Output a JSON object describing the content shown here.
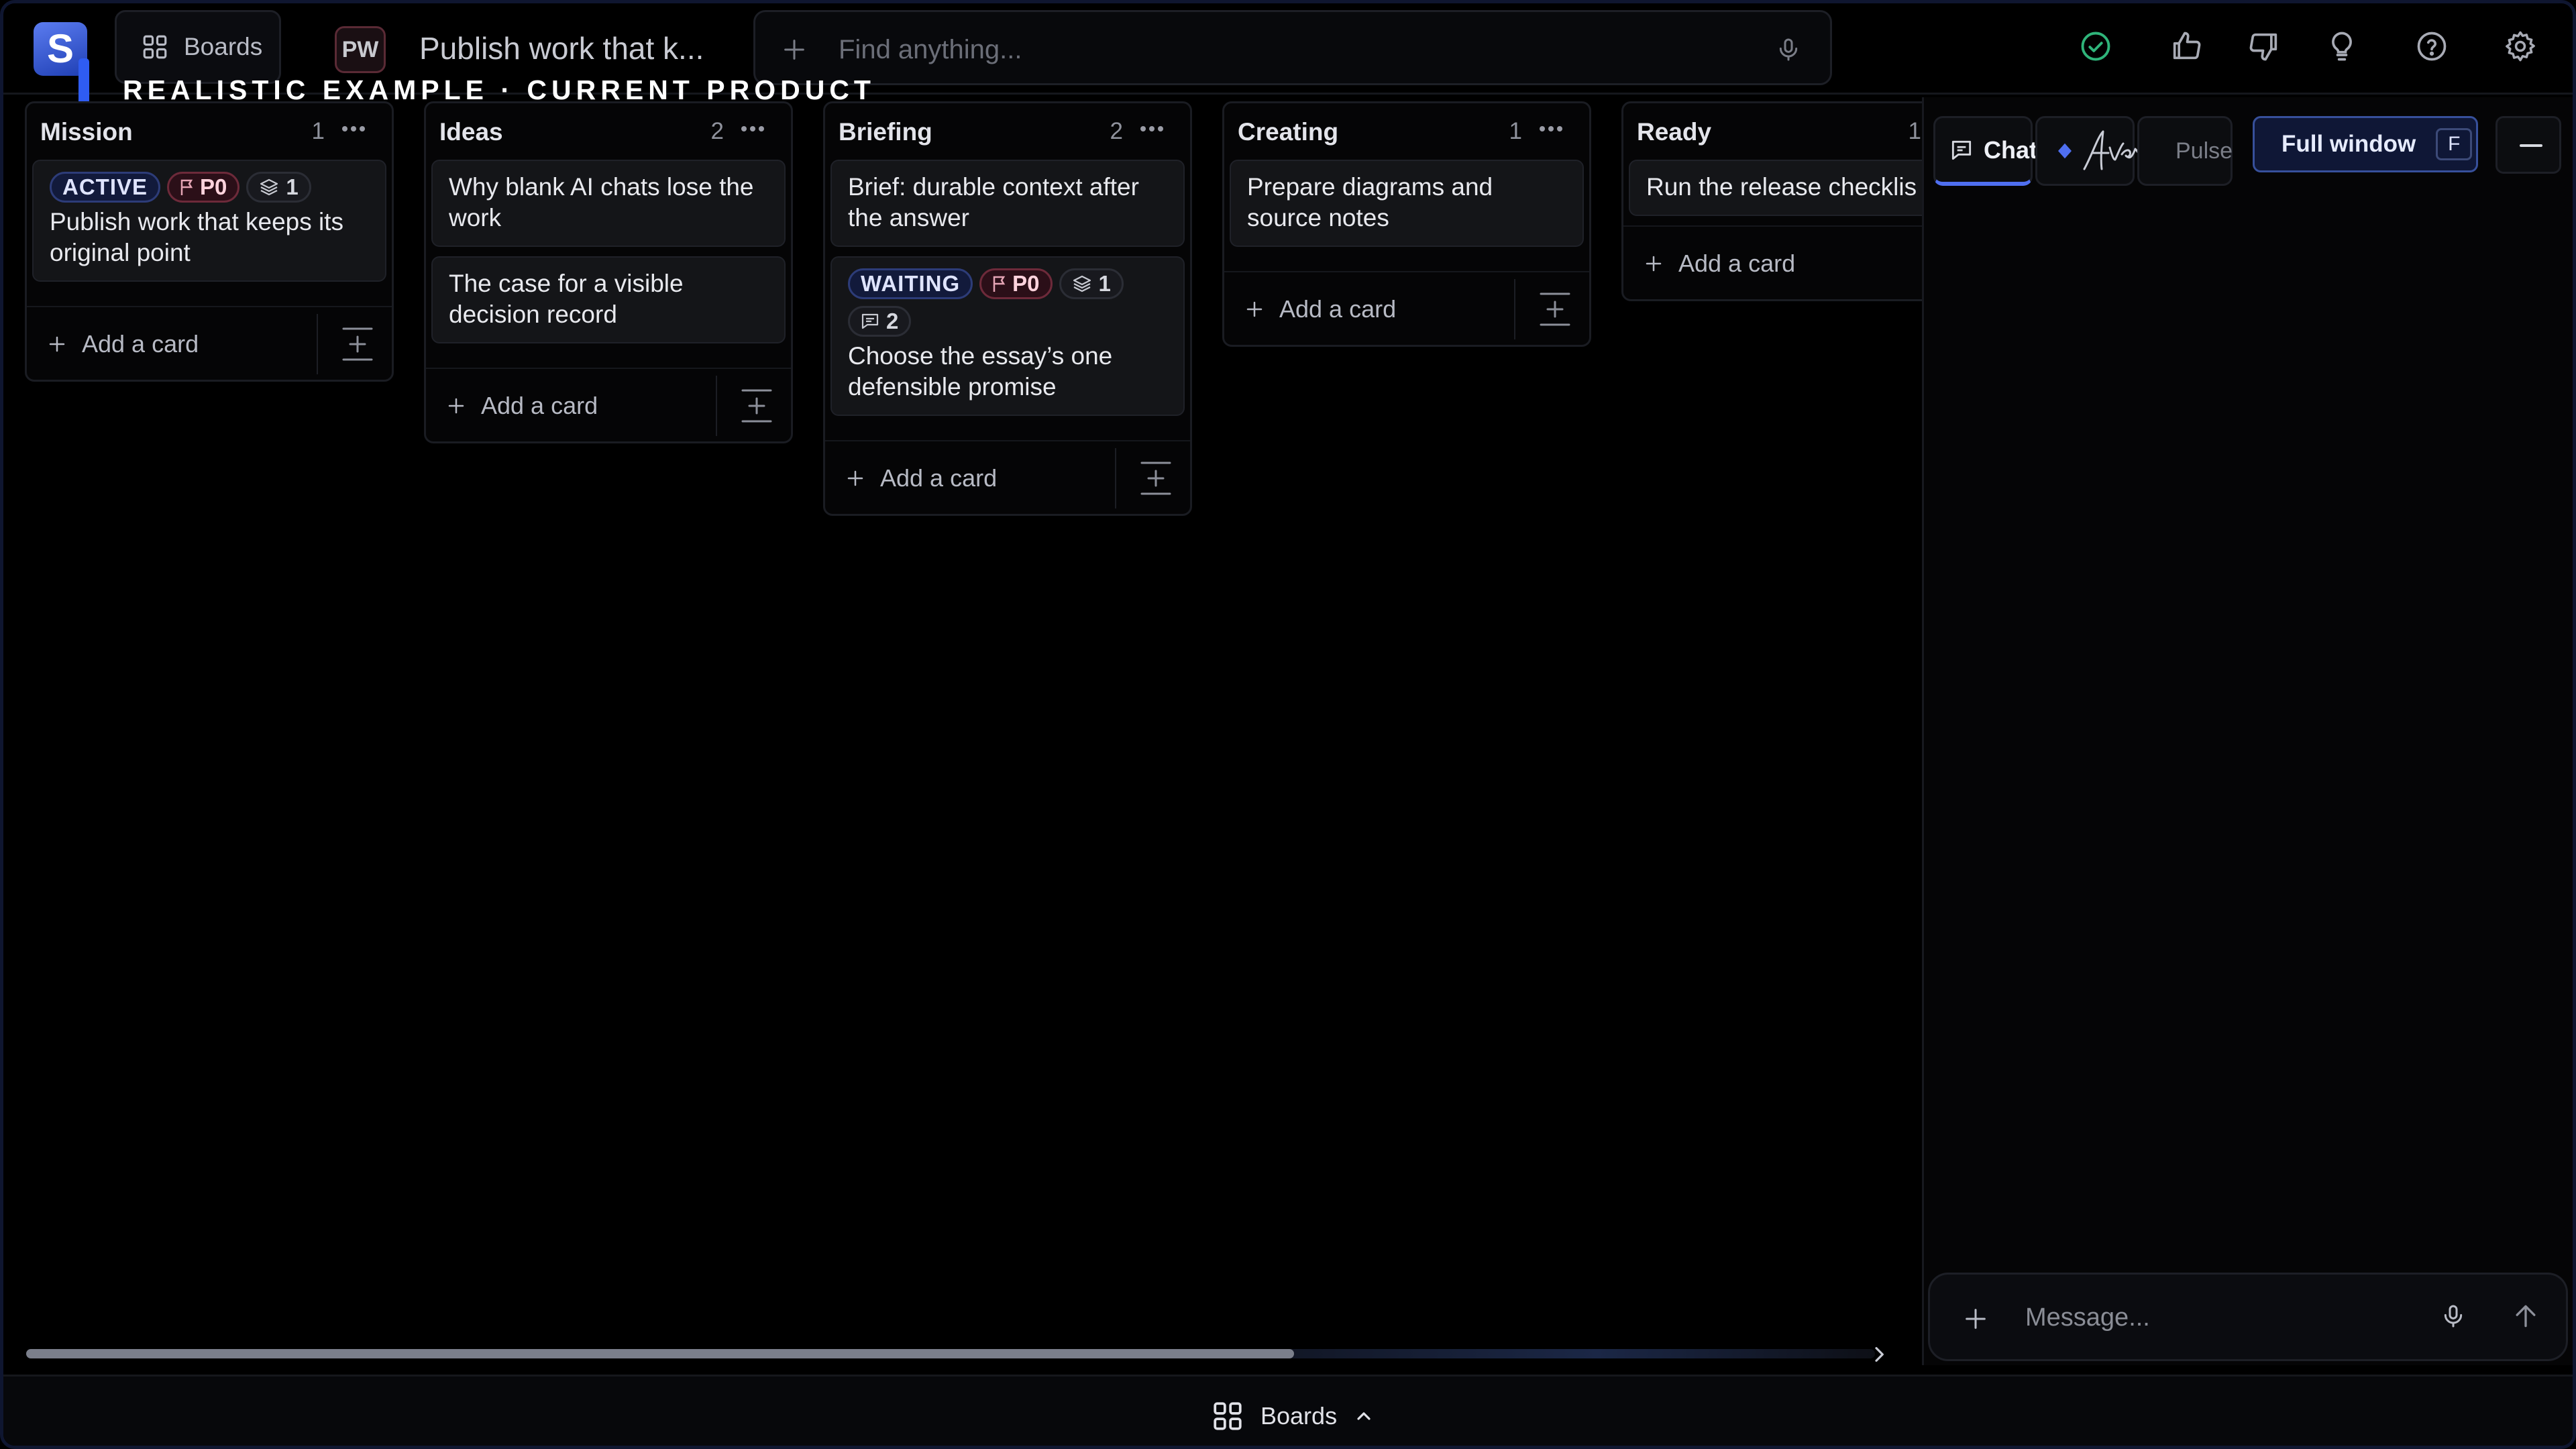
{
  "app": {
    "logo_letter": "S"
  },
  "topbar": {
    "boards_label": "Boards",
    "project_badge": "PW",
    "page_title": "Publish work that k...",
    "search_placeholder": "Find anything...",
    "icons": [
      "status-ok-icon",
      "thumbs-up-icon",
      "thumbs-down-icon",
      "lightbulb-icon",
      "help-icon",
      "settings-icon"
    ]
  },
  "watermark": "REALISTIC EXAMPLE · CURRENT PRODUCT",
  "columns": [
    {
      "title": "Mission",
      "count": "1",
      "cards": [
        {
          "badges": {
            "state": "ACTIVE",
            "priority": "P0",
            "stack": "1"
          },
          "text": "Publish work that keeps its original point"
        }
      ],
      "add_label": "Add a card"
    },
    {
      "title": "Ideas",
      "count": "2",
      "cards": [
        {
          "text": "Why blank AI chats lose the work"
        },
        {
          "text": "The case for a visible decision record"
        }
      ],
      "add_label": "Add a card"
    },
    {
      "title": "Briefing",
      "count": "2",
      "cards": [
        {
          "text": "Brief: durable context after the answer"
        },
        {
          "badges": {
            "state": "WAITING",
            "priority": "P0",
            "stack": "1",
            "comments": "2"
          },
          "text": "Choose the essay’s one defensible promise"
        }
      ],
      "add_label": "Add a card"
    },
    {
      "title": "Creating",
      "count": "1",
      "cards": [
        {
          "text": "Prepare diagrams and source notes"
        }
      ],
      "add_label": "Add a card"
    },
    {
      "title": "Ready",
      "count": "1",
      "cards": [
        {
          "text": "Run the release checklis"
        }
      ],
      "add_label": "Add a card"
    }
  ],
  "bottombar": {
    "label": "Boards"
  },
  "chat": {
    "tab_chat": "Chat",
    "tab_pulse": "Pulse",
    "full_window_label": "Full window",
    "full_window_key": "F",
    "message_placeholder": "Message..."
  },
  "colors": {
    "accent": "#4f6ff0",
    "status_ok": "#2fb47a",
    "priority_border": "#6d2a3a",
    "state_border": "#2d3c78"
  }
}
